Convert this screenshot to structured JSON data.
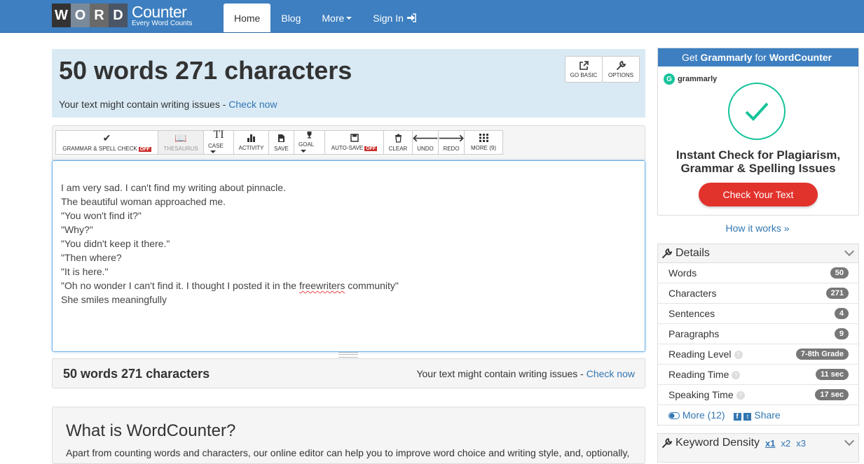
{
  "brand": {
    "letters": [
      "W",
      "O",
      "R",
      "D"
    ],
    "letter_colors": [
      "#333333",
      "#7b8a9a",
      "#6a6a6a",
      "#4a5566"
    ],
    "name": "Counter",
    "tagline": "Every Word Counts"
  },
  "nav": {
    "items": [
      {
        "label": "Home",
        "active": true
      },
      {
        "label": "Blog"
      },
      {
        "label": "More"
      },
      {
        "label": "Sign In"
      }
    ]
  },
  "header": {
    "title": "50 words 271 characters",
    "issues_text": "Your text might contain writing issues - ",
    "issues_link": "Check now",
    "buttons": [
      {
        "label": "GO BASIC",
        "icon": "external-link-icon"
      },
      {
        "label": "OPTIONS",
        "icon": "wrench-icon"
      }
    ]
  },
  "toolbar": {
    "grammar": "GRAMMAR & SPELL CHECK",
    "off": "OFF",
    "thesaurus": "THESAURUS",
    "case": "CASE",
    "activity": "ACTIVITY",
    "save": "SAVE",
    "goal": "GOAL",
    "autosave": "AUTO-SAVE",
    "clear": "CLEAR",
    "undo": "UNDO",
    "redo": "REDO",
    "more": "MORE (9)"
  },
  "editor": {
    "lines": [
      "I am very sad. I can't find my writing about pinnacle.",
      "The beautiful woman approached me.",
      "\"You won't find it?\"",
      "\"Why?\"",
      "\"You didn't keep it there.\"",
      "\"Then where?",
      "\"It is here.\"",
      "\"Oh no wonder I can't find it. I thought I posted it in the ",
      "She smiles meaningfully"
    ],
    "misspelled": "freewriters",
    "line8_end": " community\""
  },
  "bottom": {
    "count": "50 words 271 characters",
    "issues_text": "Your text might contain writing issues - ",
    "issues_link": "Check now"
  },
  "about": {
    "title": "What is WordCounter?",
    "text": "Apart from counting words and characters, our online editor can help you to improve word choice and writing style, and, optionally,"
  },
  "ad": {
    "head_pre": "Get",
    "head_brand": "Grammarly",
    "head_mid": "for",
    "head_site": "WordCounter",
    "logo": "grammarly",
    "title_line1": "Instant Check for Plagiarism,",
    "title_line2": "Grammar & Spelling Issues",
    "cta": "Check Your Text",
    "how": "How it works »"
  },
  "details": {
    "title": "Details",
    "rows": [
      {
        "label": "Words",
        "value": "50"
      },
      {
        "label": "Characters",
        "value": "271"
      },
      {
        "label": "Sentences",
        "value": "4"
      },
      {
        "label": "Paragraphs",
        "value": "9"
      },
      {
        "label": "Reading Level",
        "value": "7-8th Grade"
      },
      {
        "label": "Reading Time",
        "value": "11 sec"
      },
      {
        "label": "Speaking Time",
        "value": "17 sec"
      }
    ],
    "more": "More (12)",
    "share": "Share"
  },
  "keyword_density": {
    "title": "Keyword Density",
    "x1": "x1",
    "x2": "x2",
    "x3": "x3"
  }
}
